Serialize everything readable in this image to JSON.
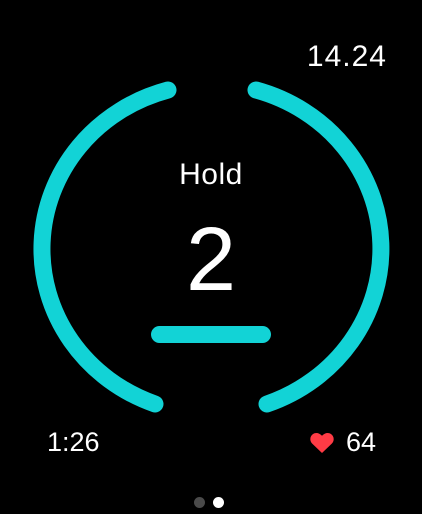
{
  "status": {
    "time": "14.24"
  },
  "breathe": {
    "phase_label": "Hold",
    "count": "2",
    "elapsed": "1:26",
    "heart_rate": "64"
  },
  "pager": {
    "pages": 2,
    "active_index": 1
  },
  "colors": {
    "accent": "#12d3d6",
    "heart": "#ff3b45",
    "background": "#000000"
  },
  "icons": {
    "heart": "heart-icon"
  }
}
